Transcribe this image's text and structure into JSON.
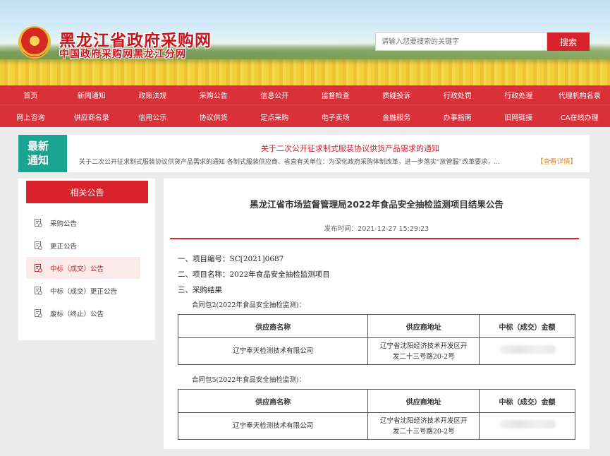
{
  "header": {
    "site_title": "黑龙江省政府采购网",
    "site_subtitle": "中国政府采购网黑龙江分网",
    "search_placeholder": "请输入您要搜索的关键字",
    "search_button": "搜索"
  },
  "nav": {
    "row1": [
      "首页",
      "新闻通知",
      "政策法规",
      "采购公告",
      "信息公开",
      "监督检查",
      "质疑投诉",
      "行政处罚",
      "行政处理",
      "代理机构名录"
    ],
    "row2": [
      "网上咨询",
      "供应商名录",
      "信用公示",
      "协议供货",
      "定点采购",
      "电子卖场",
      "金融服务",
      "办事指南",
      "旧网链接",
      "CA在线办理"
    ]
  },
  "notice": {
    "badge_line1": "最新",
    "badge_line2": "通知",
    "title": "关于二次公开征求制式服装协议供货产品需求的通知",
    "summary": "关于二次公开征求制式服装协议供货产品需求的通知 各制式服装供应商、省直有关单位：为深化政府采购体制改革，进一步落实“放管服”改革要求，...",
    "more": "【查看详情】"
  },
  "sidebar": {
    "title": "相关公告",
    "items": [
      {
        "label": "采购公告"
      },
      {
        "label": "更正公告"
      },
      {
        "label": "中标（成交）公告"
      },
      {
        "label": "中标（成交）更正公告"
      },
      {
        "label": "废标（终止）公告"
      }
    ],
    "active_index": 2
  },
  "article": {
    "title": "黑龙江省市场监督管理局2022年食品安全抽检监测项目结果公告",
    "publish_time": "发布时间：2021-12-27 15:29:23",
    "section1": "一、项目编号：SC[2021]0687",
    "section2": "二、项目名称：2022年食品安全抽检监测项目",
    "section3": "三、采购结果",
    "packages": [
      {
        "label": "合同包2(2022年食品安全抽检监测)：",
        "headers": [
          "供应商名称",
          "供应商地址",
          "中标（成交）金额"
        ],
        "supplier": "辽宁奉天检测技术有限公司",
        "address_line1": "辽宁省沈阳经济技术开发区开",
        "address_line2": "发二十三号路20-2号"
      },
      {
        "label": "合同包5(2022年食品安全抽检监测)：",
        "headers": [
          "供应商名称",
          "供应商地址",
          "中标（成交）金额"
        ],
        "supplier": "辽宁奉天检测技术有限公司",
        "address_line1": "辽宁省沈阳经济技术开发区开",
        "address_line2": "发二十三号路20-2号"
      }
    ]
  },
  "colors": {
    "brand_red": "#d8232c",
    "nav_red": "#d9303a",
    "notice_teal": "#1aa592",
    "more_orange": "#e08a1c"
  }
}
